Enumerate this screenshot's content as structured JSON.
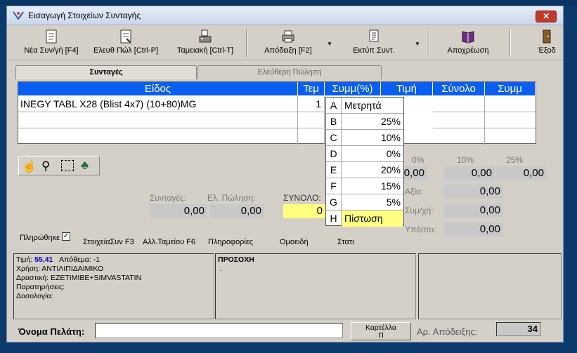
{
  "window": {
    "title": "Εισαγωγή Στοιχείων Συνταγής",
    "close_label": "✕"
  },
  "toolbar": {
    "items": [
      {
        "label": "Νέα Συν/γή [F4]",
        "icon": "document-icon"
      },
      {
        "label": "Ελευθ Πώλ [Ctrl-P]",
        "icon": "document-icon"
      },
      {
        "label": "Ταμειακή [Ctrl-T]",
        "icon": "register-icon"
      },
      {
        "label": "Απόδειξη [F2]",
        "icon": "printer-icon"
      },
      {
        "label": "Εκτύπ Συντ.",
        "icon": "print-doc-icon"
      },
      {
        "label": "Αποχρέωση",
        "icon": "book-icon"
      },
      {
        "label": "Έξοδ",
        "icon": "exit-door-icon"
      }
    ]
  },
  "tabs": [
    {
      "label": "Συνταγές",
      "active": true
    },
    {
      "label": "Ελεύθερη Πώληση",
      "active": false
    }
  ],
  "grid": {
    "headers": [
      "Είδος",
      "Τεμ",
      "Συμμ(%)",
      "Τιμή",
      "Σύνολο",
      "Συμμ"
    ],
    "rows": [
      {
        "item": "INEGY TABL X28 (Blist 4x7) (10+80)MG",
        "qty": "1"
      }
    ]
  },
  "dropdown": {
    "options": [
      {
        "key": "A",
        "value": "Μετρητά"
      },
      {
        "key": "B",
        "value": "25%"
      },
      {
        "key": "C",
        "value": "10%"
      },
      {
        "key": "D",
        "value": "0%"
      },
      {
        "key": "E",
        "value": "20%"
      },
      {
        "key": "F",
        "value": "15%"
      },
      {
        "key": "G",
        "value": "5%"
      },
      {
        "key": "H",
        "value": "Πίστωση"
      }
    ]
  },
  "percent_totals": {
    "headers": [
      "0%",
      "10%",
      "25%"
    ],
    "values": [
      "0,00",
      "0,00",
      "0,00"
    ]
  },
  "summary": {
    "syntages_label": "Συνταγές:",
    "el_polisi_label": "Ελ. Πώληση:",
    "synolo_label": "ΣΥΝΟΛΟ:",
    "syntages_value": "0,00",
    "el_polisi_value": "0,00",
    "synolo_value": "0",
    "axia_label": "Αξία:",
    "axia_value": "0,00",
    "symm_label": "Συμ/χή:",
    "symm_value": "0,00",
    "ypoloipo_label": "Υπό/πο:",
    "ypoloipo_value": "0,00"
  },
  "links": {
    "paid_label": "Πληρώθηκε",
    "stoixeia": "ΣτοιχείαΣυν F3",
    "all_tameiou": "Αλλ.Ταμείου F6",
    "pliroforíes": "Πληροφορίες",
    "omoeidi": "Ομοειδή",
    "stati": "Στατι"
  },
  "info": {
    "price_label": "Τιμή:",
    "price_value": "55,41",
    "stock_label": "Απόθεμα:",
    "stock_value": "-1",
    "use_line": "Χρήση: ΑΝΤΙΛΙΠΙΔΑΙΜΙΚΟ",
    "active_line": "Δραστική: EZETIMIBE+SIMVASTATIN",
    "notes_line": "Παρατηρήσεις:",
    "dosage_line": "Δοσολογία:",
    "warning_title": "ΠΡΟΣΟΧΗ",
    "warning_text": "."
  },
  "footer": {
    "customer_label": "Όνομα Πελάτη:",
    "card_button": "Καρτέλλα",
    "card_sub": "Π",
    "receipt_label": "Αρ. Απόδειξης:",
    "receipt_value": "34"
  },
  "colors": {
    "grid_header": "#0a5ef0",
    "highlight": "#ffff80",
    "price_blue": "#0000c0"
  }
}
